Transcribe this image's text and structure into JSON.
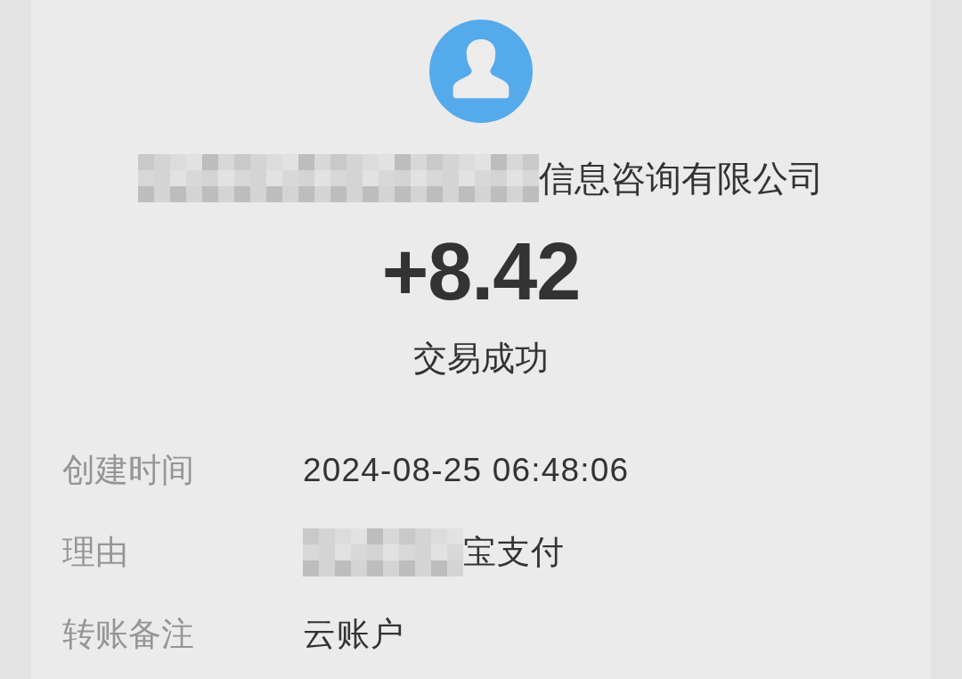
{
  "payee": {
    "redacted": true,
    "text": "信息咨询有限公司"
  },
  "amount": "+8.42",
  "status": "交易成功",
  "details": [
    {
      "label": "创建时间",
      "value": "2024-08-25 06:48:06",
      "redacted": false
    },
    {
      "label": "理由",
      "value": "宝支付",
      "redacted": true
    },
    {
      "label": "转账备注",
      "value": "云账户",
      "redacted": false
    }
  ]
}
